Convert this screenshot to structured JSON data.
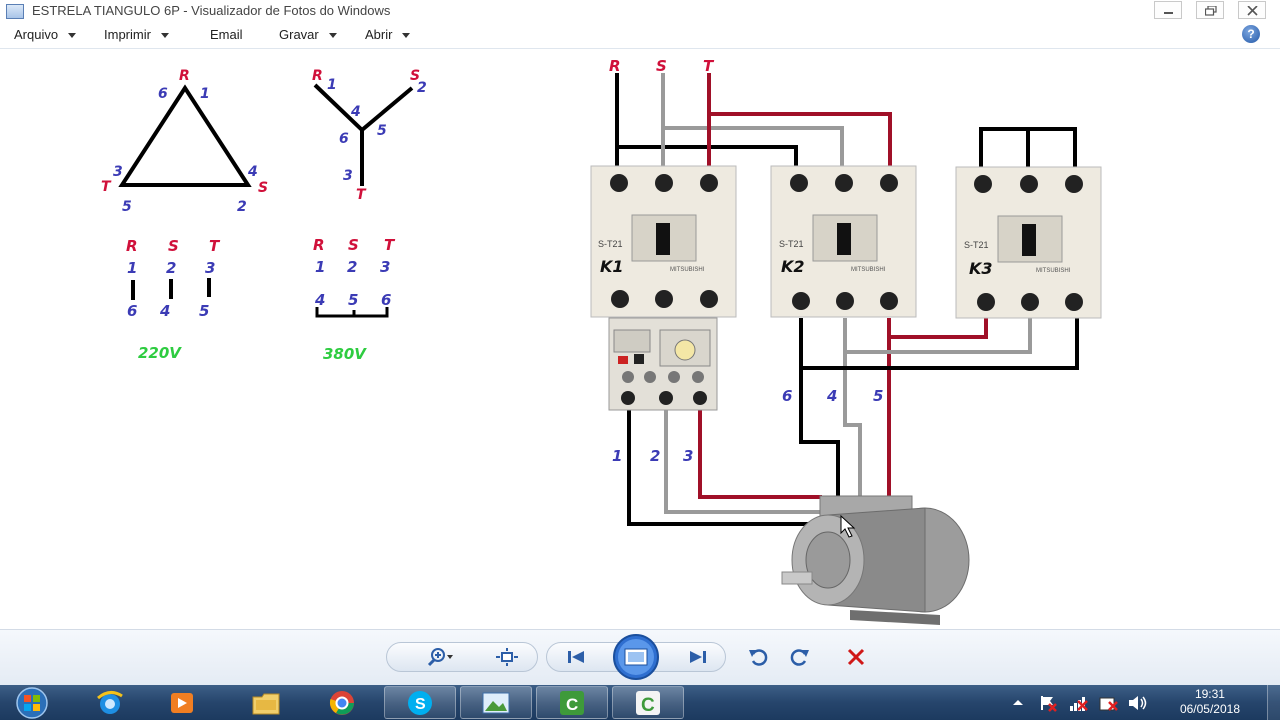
{
  "window": {
    "title": "ESTRELA TIANGULO 6P - Visualizador de Fotos do Windows"
  },
  "menu": {
    "items": [
      {
        "label": "Arquivo",
        "has_arrow": true
      },
      {
        "label": "Imprimir",
        "has_arrow": true
      },
      {
        "label": "Email",
        "has_arrow": false
      },
      {
        "label": "Gravar",
        "has_arrow": true
      },
      {
        "label": "Abrir",
        "has_arrow": true
      }
    ],
    "help_label": "?"
  },
  "diagram": {
    "delta": {
      "vertex_top": "R",
      "vertex_left": "T",
      "vertex_right": "S",
      "top_left_num": "6",
      "top_right_num": "1",
      "left_num": "3",
      "left_bottom_num": "5",
      "right_num": "4",
      "right_bottom_num": "2",
      "phases": [
        "R",
        "S",
        "T"
      ],
      "top_nums": [
        "1",
        "2",
        "3"
      ],
      "bottom_nums": [
        "6",
        "4",
        "5"
      ],
      "voltage": "220V"
    },
    "star": {
      "r": "R",
      "s": "S",
      "t": "T",
      "n1": "1",
      "n2": "2",
      "n3": "3",
      "n4": "4",
      "n5": "5",
      "n6": "6",
      "phases": [
        "R",
        "S",
        "T"
      ],
      "top_nums": [
        "1",
        "2",
        "3"
      ],
      "bottom_nums": [
        "4",
        "5",
        "6"
      ],
      "voltage": "380V"
    },
    "supply": {
      "r": "R",
      "s": "S",
      "t": "T"
    },
    "contactors": {
      "k1": "K1",
      "k2": "K2",
      "k3": "K3",
      "model": "S-T21",
      "brand": "MITSUBISHI"
    },
    "motor_terminals": {
      "t6": "6",
      "t4": "4",
      "t5": "5",
      "t1": "1",
      "t2": "2",
      "t3": "3"
    },
    "colors": {
      "red": "#d0103a",
      "blue": "#3b3bb5",
      "green": "#2ecc40",
      "wire_black": "#000000",
      "wire_gray": "#9a9a9a",
      "wire_red": "#a01028"
    }
  },
  "toolbar": {
    "zoom": "zoom-icon",
    "fit": "fit-window-icon",
    "previous": "previous-icon",
    "slideshow": "slideshow-icon",
    "next": "next-icon",
    "rotate_left": "rotate-left-icon",
    "rotate_right": "rotate-right-icon",
    "delete": "delete-icon"
  },
  "taskbar": {
    "time": "19:31",
    "date": "06/05/2018"
  }
}
